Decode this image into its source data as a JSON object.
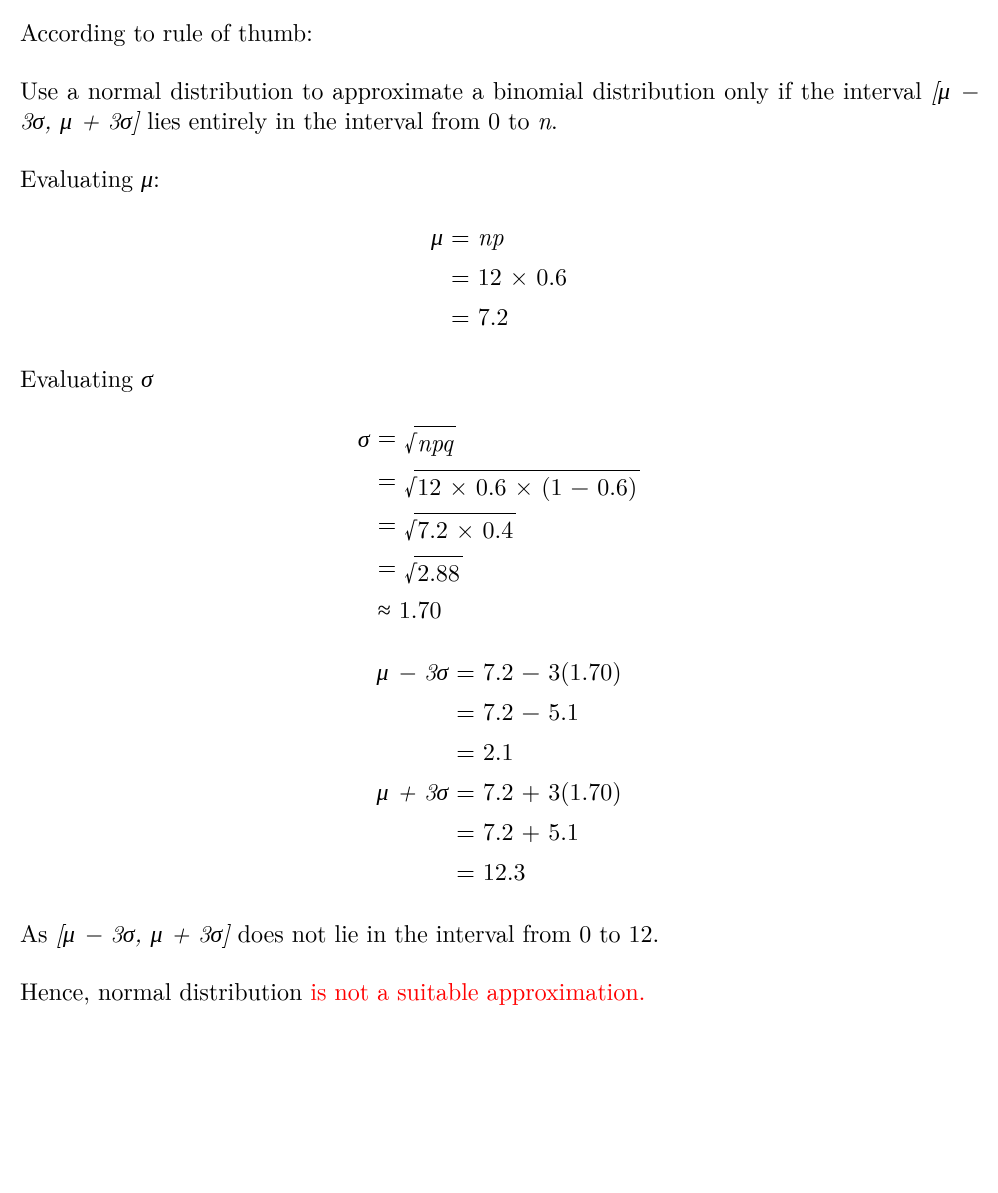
{
  "intro": {
    "line1": "According to rule of thumb:",
    "rule_pre": "Use a normal distribution to approximate a binomial distribution only if the interval ",
    "rule_interval": "[μ − 3σ, μ + 3σ]",
    "rule_post_a": " lies entirely in the interval from 0 to ",
    "rule_n": "n",
    "rule_post_b": "."
  },
  "mu": {
    "heading": "Evaluating μ:",
    "steps": [
      {
        "lhs": "μ",
        "rel": "=",
        "rhs_plain": "np",
        "rhs_italic": true
      },
      {
        "lhs": "",
        "rel": "=",
        "rhs_plain": "12 × 0.6"
      },
      {
        "lhs": "",
        "rel": "=",
        "rhs_plain": "7.2"
      }
    ]
  },
  "sigma": {
    "heading": "Evaluating σ",
    "steps": [
      {
        "lhs": "σ",
        "rel": "=",
        "sqrt_of": "npq",
        "sqrt_italic": true
      },
      {
        "lhs": "",
        "rel": "=",
        "sqrt_of": "12 × 0.6 × (1 − 0.6)"
      },
      {
        "lhs": "",
        "rel": "=",
        "sqrt_of": "7.2 × 0.4"
      },
      {
        "lhs": "",
        "rel": "=",
        "sqrt_of": "2.88"
      },
      {
        "lhs": "",
        "rel": "≈",
        "rhs_plain": "1.70"
      }
    ]
  },
  "bounds": {
    "steps": [
      {
        "lhs": "μ − 3σ",
        "rel": "=",
        "rhs_plain": "7.2 − 3(1.70)"
      },
      {
        "lhs": "",
        "rel": "=",
        "rhs_plain": "7.2 − 5.1"
      },
      {
        "lhs": "",
        "rel": "=",
        "rhs_plain": "2.1"
      },
      {
        "lhs": "μ + 3σ",
        "rel": "=",
        "rhs_plain": "7.2 + 3(1.70)"
      },
      {
        "lhs": "",
        "rel": "=",
        "rhs_plain": "7.2 + 5.1"
      },
      {
        "lhs": "",
        "rel": "=",
        "rhs_plain": "12.3"
      }
    ]
  },
  "conclusion": {
    "line_a_pre": "As ",
    "line_a_interval": "[μ − 3σ, μ + 3σ]",
    "line_a_post": " does not lie in the interval from 0 to 12.",
    "line_b_pre": "Hence, normal distribution ",
    "line_b_red": "is not a suitable approximation.",
    "line_b_post": ""
  }
}
